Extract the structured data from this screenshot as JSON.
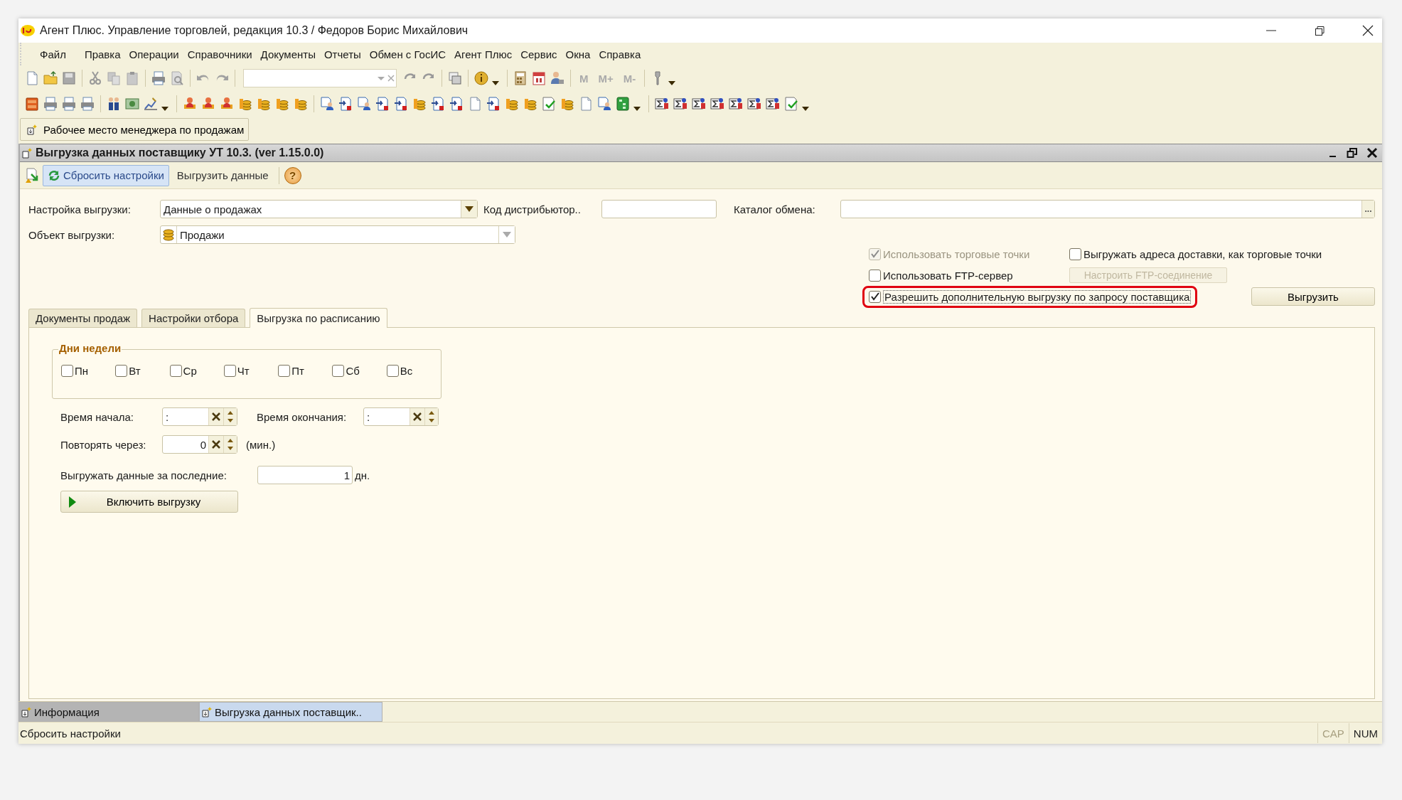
{
  "window": {
    "title": "Агент Плюс. Управление торговлей, редакция 10.3 / Федоров Борис Михайлович"
  },
  "menu": [
    "Файл",
    "Правка",
    "Операции",
    "Справочники",
    "Документы",
    "Отчеты",
    "Обмен с ГосИС",
    "Агент Плюс",
    "Сервис",
    "Окна",
    "Справка"
  ],
  "toolbar": {
    "memory_buttons": [
      "M",
      "M+",
      "M-"
    ]
  },
  "panel": {
    "button": "Рабочее место менеджера по продажам"
  },
  "form": {
    "title": "Выгрузка данных поставщику УТ 10.3. (ver 1.15.0.0)",
    "actions": [
      {
        "label": "Сбросить настройки",
        "selected": true
      },
      {
        "label": "Выгрузить данные",
        "selected": false
      }
    ],
    "help_button": "?",
    "settings": {
      "label": "Настройка выгрузки:",
      "value": "Данные о продажах"
    },
    "distributor": {
      "label": "Код дистрибьютор.."
    },
    "catalog": {
      "label": "Каталог обмена:",
      "browse_button": "..."
    },
    "object": {
      "label": "Объект выгрузки:",
      "value": "Продажи"
    },
    "options": [
      {
        "label": "Использовать торговые точки",
        "checked": true,
        "disabled": true,
        "highlighted": false
      },
      {
        "label": "Выгружать адреса доставки, как торговые точки",
        "checked": false,
        "disabled": false,
        "highlighted": false
      },
      {
        "label": "Использовать FTP-сервер",
        "checked": false,
        "disabled": false,
        "highlighted": false
      },
      {
        "label": "Разрешить дополнительную выгрузку по запросу поставщика",
        "checked": true,
        "disabled": false,
        "highlighted": true
      }
    ],
    "ftp_button": {
      "label": "Настроить FTP-соединение",
      "disabled": true
    },
    "export_button": "Выгрузить",
    "tabs": [
      {
        "label": "Документы продаж",
        "selected": false
      },
      {
        "label": "Настройки отбора",
        "selected": false
      },
      {
        "label": "Выгрузка по расписанию",
        "selected": true
      }
    ],
    "schedule": {
      "group_title": "Дни недели",
      "days": [
        {
          "label": "Пн",
          "checked": false
        },
        {
          "label": "Вт",
          "checked": false
        },
        {
          "label": "Ср",
          "checked": false
        },
        {
          "label": "Чт",
          "checked": false
        },
        {
          "label": "Пт",
          "checked": false
        },
        {
          "label": "Сб",
          "checked": false
        },
        {
          "label": "Вс",
          "checked": false
        }
      ],
      "start": {
        "label": "Время начала:",
        "value": ":"
      },
      "end": {
        "label": "Время окончания:",
        "value": ":"
      },
      "repeat": {
        "label": "Повторять через:",
        "value": "0",
        "unit": "(мин.)"
      },
      "period": {
        "label": "Выгружать данные за последние:",
        "value": "1",
        "unit": "дн."
      },
      "enable_button": "Включить выгрузку"
    }
  },
  "taskbar": [
    {
      "label": "Информация",
      "selected": false
    },
    {
      "label": "Выгрузка данных поставщик..",
      "selected": true
    }
  ],
  "status_bar": {
    "text": "Сбросить настройки",
    "indicators": [
      {
        "label": "CAP",
        "on": false
      },
      {
        "label": "NUM",
        "on": true
      }
    ]
  }
}
